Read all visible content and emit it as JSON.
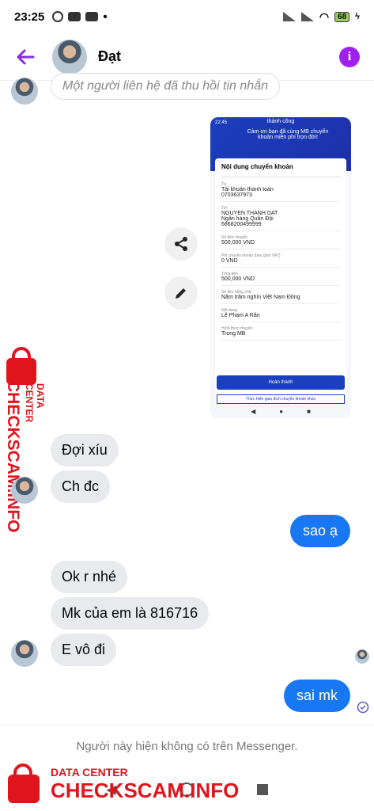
{
  "status": {
    "time": "23:25",
    "battery": "68"
  },
  "header": {
    "name": "Đạt"
  },
  "messages": {
    "recalled": "Một người liên hệ đã thu hồi tin nhắn",
    "incoming": [
      "Đợi xíu",
      "Ch đc",
      "Ok r nhé",
      "Mk của em là 816716",
      "E vô đi"
    ],
    "outgoing": [
      "sao ạ",
      "sai mk"
    ]
  },
  "shared_screenshot": {
    "status_time": "22:45",
    "banner_title": "thành công",
    "banner_text": "Cảm ơn bạn đã cùng MB chuyển khoản miễn phí trọn đời!",
    "card_title": "Nội dung chuyển khoản",
    "rows": [
      {
        "label": "Từ",
        "value": "Tài khoản thanh toán\n0703637973"
      },
      {
        "label": "Tới",
        "value": "NGUYEN THANH DAT\nNgân hàng Quân Đội\n6868200499999"
      },
      {
        "label": "Số tiền chuyển",
        "value": "500,000 VND"
      },
      {
        "label": "Phí chuyển khoản (bao gồm VAT)",
        "value": "0 VND"
      },
      {
        "label": "Tổng tiền",
        "value": "500,000 VND"
      },
      {
        "label": "Số tiền bằng chữ",
        "value": "Năm trăm nghìn Việt Nam Đồng"
      },
      {
        "label": "Nội dung",
        "value": "Lê Phạm A Rân"
      },
      {
        "label": "Hình thức chuyển",
        "value": "Trong MB"
      }
    ],
    "button": "Hoàn thành",
    "link": "Thực hiện giao dịch chuyển khoản khác"
  },
  "watermark": {
    "side_top": "DATA CENTER",
    "side_main": "CHECKSCAM.INFO",
    "bottom_top": "DATA CENTER",
    "bottom_main": "CHECKSCAM.INFO"
  },
  "footer": {
    "notice": "Người này hiện không có trên Messenger."
  },
  "colors": {
    "accent": "#1877f2",
    "brand_purple": "#a020f0",
    "watermark_red": "#e0141c"
  }
}
